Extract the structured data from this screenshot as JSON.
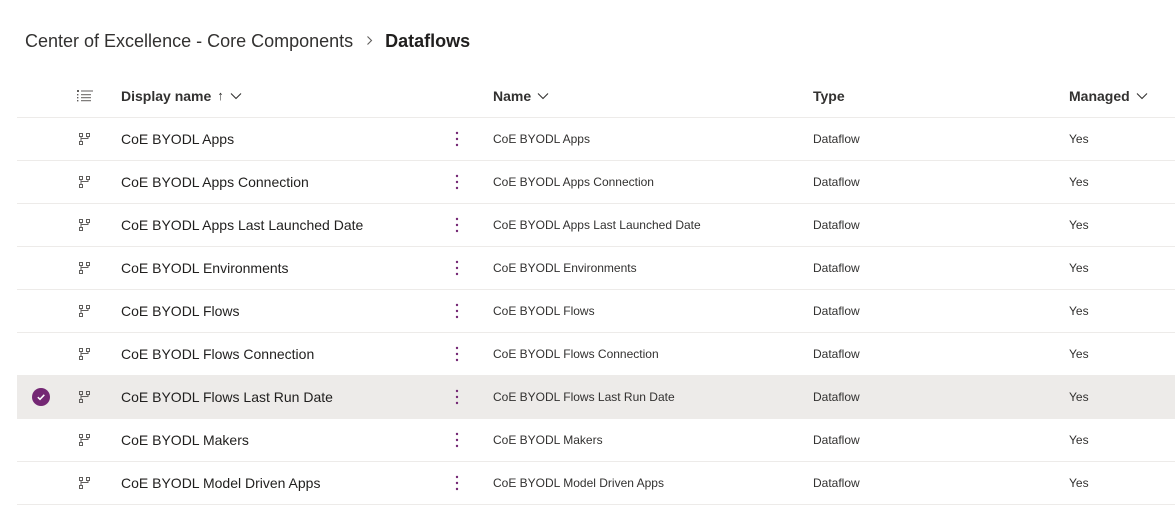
{
  "breadcrumb": {
    "parent": "Center of Excellence - Core Components",
    "current": "Dataflows"
  },
  "columns": {
    "display_name": "Display name",
    "sort_indicator": "↑",
    "name": "Name",
    "type": "Type",
    "managed": "Managed"
  },
  "colors": {
    "accent": "#742774",
    "selected_row": "#edebe9",
    "border": "#edebe9"
  },
  "icons": {
    "list": "list-icon",
    "dataflow": "dataflow-icon",
    "more": "more-vertical-icon",
    "chevron": "chevron-down-icon",
    "check": "checkmark-icon"
  },
  "rows": [
    {
      "display_name": "CoE BYODL Apps",
      "name": "CoE BYODL Apps",
      "type": "Dataflow",
      "managed": "Yes",
      "selected": false
    },
    {
      "display_name": "CoE BYODL Apps Connection",
      "name": "CoE BYODL Apps Connection",
      "type": "Dataflow",
      "managed": "Yes",
      "selected": false
    },
    {
      "display_name": "CoE BYODL Apps Last Launched Date",
      "name": "CoE BYODL Apps Last Launched Date",
      "type": "Dataflow",
      "managed": "Yes",
      "selected": false
    },
    {
      "display_name": "CoE BYODL Environments",
      "name": "CoE BYODL Environments",
      "type": "Dataflow",
      "managed": "Yes",
      "selected": false
    },
    {
      "display_name": "CoE BYODL Flows",
      "name": "CoE BYODL Flows",
      "type": "Dataflow",
      "managed": "Yes",
      "selected": false
    },
    {
      "display_name": "CoE BYODL Flows Connection",
      "name": "CoE BYODL Flows Connection",
      "type": "Dataflow",
      "managed": "Yes",
      "selected": false
    },
    {
      "display_name": "CoE BYODL Flows Last Run Date",
      "name": "CoE BYODL Flows Last Run Date",
      "type": "Dataflow",
      "managed": "Yes",
      "selected": true
    },
    {
      "display_name": "CoE BYODL Makers",
      "name": "CoE BYODL Makers",
      "type": "Dataflow",
      "managed": "Yes",
      "selected": false
    },
    {
      "display_name": "CoE BYODL Model Driven Apps",
      "name": "CoE BYODL Model Driven Apps",
      "type": "Dataflow",
      "managed": "Yes",
      "selected": false
    }
  ]
}
